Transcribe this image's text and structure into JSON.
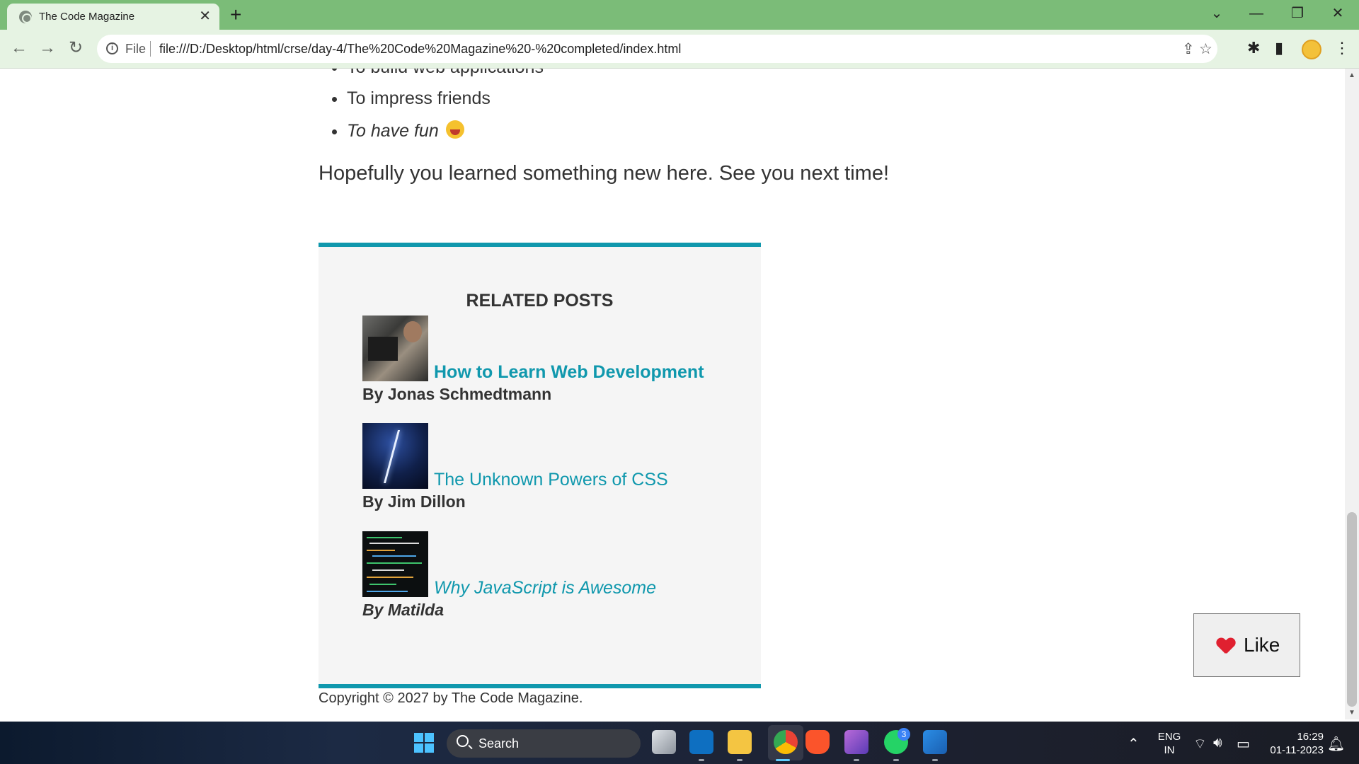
{
  "browser": {
    "tab_title": "The Code Magazine",
    "tab_close": "✕",
    "new_tab": "+",
    "file_label": "File",
    "url": "file:///D:/Desktop/html/crse/day-4/The%20Code%20Magazine%20-%20completed/index.html",
    "controls": {
      "dropdown": "⌄",
      "minimize": "—",
      "restore": "❐",
      "close": "✕"
    },
    "nav": {
      "back": "←",
      "forward": "→",
      "reload": "↻"
    }
  },
  "article": {
    "list_items": [
      "To build web applications",
      "To impress friends",
      "To have fun"
    ],
    "outro": "Hopefully you learned something new here. See you next time!"
  },
  "related": {
    "heading": "RELATED POSTS",
    "posts": [
      {
        "title": "How to Learn Web Development",
        "author": "By Jonas Schmedtmann"
      },
      {
        "title": "The Unknown Powers of CSS",
        "author": "By Jim Dillon"
      },
      {
        "title": "Why JavaScript is Awesome",
        "author": "By Matilda"
      }
    ]
  },
  "footer": {
    "copyright": "Copyright © 2027 by The Code Magazine."
  },
  "like_button": {
    "label": "Like"
  },
  "taskbar": {
    "search_label": "Search",
    "whatsapp_badge": "3",
    "lang_top": "ENG",
    "lang_bottom": "IN",
    "time": "16:29",
    "date": "01-11-2023"
  },
  "colors": {
    "accent": "#1098ad",
    "titlebar": "#7bbc78",
    "toolbar": "#e6f3e3"
  }
}
